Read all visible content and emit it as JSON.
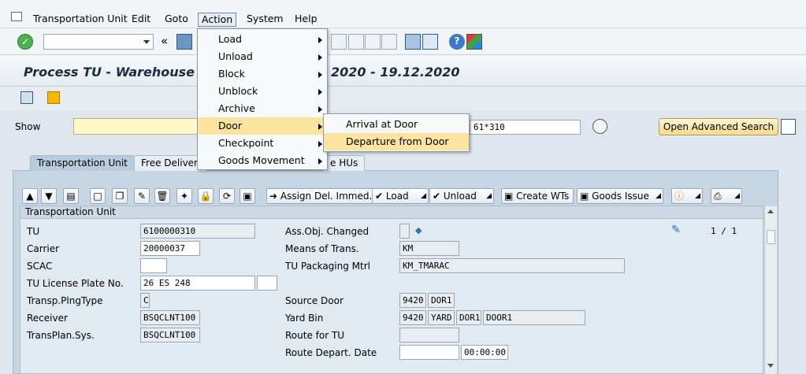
{
  "menubar": [
    "Transportation Unit",
    "Edit",
    "Goto",
    "Action",
    "System",
    "Help"
  ],
  "title": "Process TU - Warehouse 9 … 2020 - 19.12.2020",
  "title_visible_left": "Process TU - Warehouse 9",
  "title_visible_right": "2020 - 19.12.2020",
  "show_label": "Show",
  "show_value_right": "61*310",
  "advanced_search": "Open Advanced Search",
  "tabs": [
    "Transportation Unit",
    "Free Deliveri",
    "e HUs"
  ],
  "table_toolbar": {
    "assign": "Assign Del. Immed.",
    "load": "Load",
    "unload": "Unload",
    "create_wts": "Create WTs",
    "goods_issue": "Goods Issue"
  },
  "section_title": "Transportation Unit",
  "pager": "1 / 1",
  "fields_left": [
    {
      "label": "TU",
      "value": "6100000310"
    },
    {
      "label": "Carrier",
      "value": "20000037"
    },
    {
      "label": "SCAC",
      "value": ""
    },
    {
      "label": "TU License Plate No.",
      "value": "26 ES 248"
    },
    {
      "label": "Transp.PlngType",
      "value": "C"
    },
    {
      "label": "Receiver",
      "value": "BSQCLNT100"
    },
    {
      "label": "TransPlan.Sys.",
      "value": "BSQCLNT100"
    }
  ],
  "fields_right": {
    "ass_obj_changed": "Ass.Obj. Changed",
    "means_of_trans": "Means of Trans.",
    "means_value": "KM",
    "tu_pkg": "TU Packaging Mtrl",
    "tu_pkg_value": "KM_TMARAC",
    "source_door": "Source Door",
    "source_door_v1": "9420",
    "source_door_v2": "DOR1",
    "yard_bin": "Yard Bin",
    "yard_v1": "9420",
    "yard_v2": "YARD",
    "yard_v3": "DOR1",
    "yard_v4": "DOOR1",
    "route_for_tu": "Route for TU",
    "route_depart": "Route Depart. Date",
    "route_time": "00:00:00"
  },
  "action_menu": [
    "Load",
    "Unload",
    "Block",
    "Unblock",
    "Archive",
    "Door",
    "Checkpoint",
    "Goods Movement"
  ],
  "door_submenu": [
    "Arrival at Door",
    "Departure from Door"
  ],
  "colors": {
    "highlight": "#fbe3a0",
    "accent": "#f1d98c"
  }
}
